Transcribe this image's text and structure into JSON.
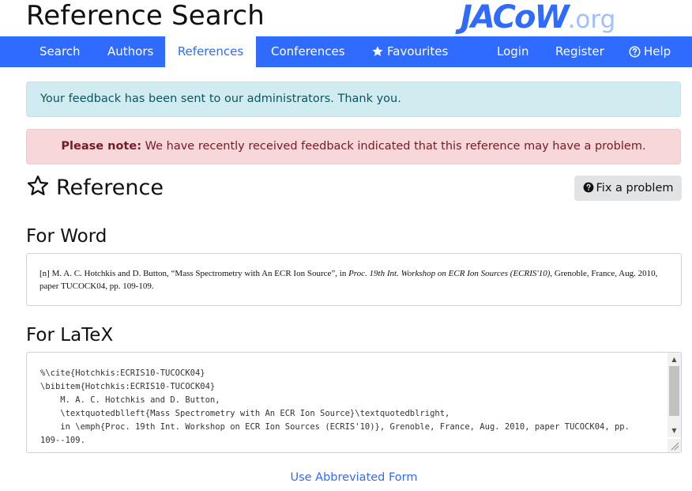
{
  "header": {
    "title": "Reference Search",
    "logo_main": "JACoW",
    "logo_suffix": ".org"
  },
  "nav": {
    "items": [
      {
        "label": "Search",
        "active": false
      },
      {
        "label": "Authors",
        "active": false
      },
      {
        "label": "References",
        "active": true
      },
      {
        "label": "Conferences",
        "active": false
      },
      {
        "label": "Favourites",
        "icon": "star-icon",
        "active": false
      },
      {
        "label": "Login",
        "active": false
      },
      {
        "label": "Register",
        "active": false
      },
      {
        "label": "Help",
        "icon": "question-circle-icon",
        "active": false
      }
    ]
  },
  "alerts": {
    "feedback_sent": "Your feedback has been sent to our administrators. Thank you.",
    "note_label": "Please note:",
    "note_text": " We have recently received feedback indicated that this reference may have a problem."
  },
  "reference": {
    "heading": "Reference",
    "heading_icon": "star-outline-icon",
    "fix_button_label": "Fix a problem",
    "fix_button_icon": "question-circle-icon"
  },
  "word": {
    "heading": "For Word",
    "prefix": "[n]   M. A. C. Hotchkis and D. Button, “Mass Spectrometry with An ECR Ion Source”, in ",
    "proceedings": "Proc. 19th Int. Workshop on ECR Ion Sources (ECRIS'10)",
    "suffix": ", Grenoble, France, Aug. 2010, paper TUCOCK04, pp. 109-109."
  },
  "latex": {
    "heading": "For LaTeX",
    "text": "%\\cite{Hotchkis:ECRIS10-TUCOCK04}\n\\bibitem{Hotchkis:ECRIS10-TUCOCK04}\n    M. A. C. Hotchkis and D. Button,\n    \\textquotedblleft{Mass Spectrometry with An ECR Ion Source}\\textquotedblright,\n    in \\emph{Proc. 19th Int. Workshop on ECR Ion Sources (ECRIS'10)}, Grenoble, France, Aug. 2010, paper TUCOCK04, pp.\n109--109."
  },
  "footer": {
    "abbrev_link": "Use Abbreviated Form"
  },
  "colors": {
    "brand_blue": "#2f6bff",
    "info_bg": "#d1ecf1",
    "danger_bg": "#f8d7da"
  }
}
